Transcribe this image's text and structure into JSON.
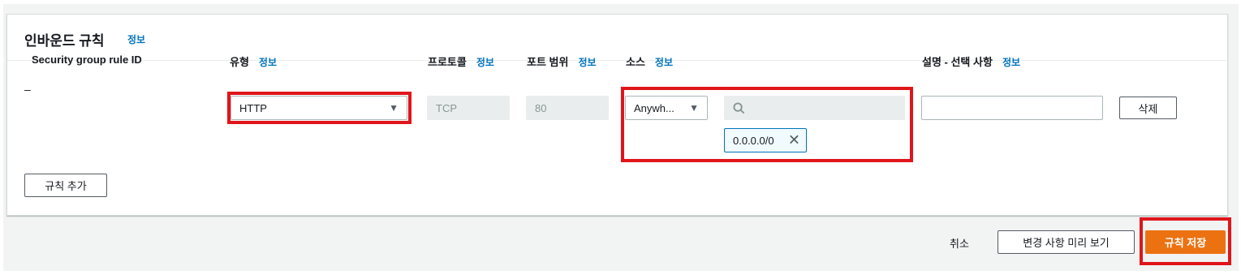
{
  "panel": {
    "title": "인바운드 규칙",
    "info": "정보"
  },
  "columns": {
    "rule_id": "Security group rule ID",
    "type": "유형",
    "type_info": "정보",
    "protocol": "프로토콜",
    "protocol_info": "정보",
    "port_range": "포트 범위",
    "port_range_info": "정보",
    "source": "소스",
    "source_info": "정보",
    "description": "설명 - 선택 사항",
    "description_info": "정보"
  },
  "rule": {
    "id": "–",
    "type": "HTTP",
    "protocol": "TCP",
    "port_range": "80",
    "source_type": "Anywh...",
    "search_placeholder": "",
    "cidr_token": "0.0.0.0/0",
    "description": "",
    "delete_label": "삭제"
  },
  "add_rule_label": "규칙 추가",
  "footer": {
    "cancel": "취소",
    "preview": "변경 사항 미리 보기",
    "save": "규칙 저장"
  },
  "icons": {
    "caret": "caret-down-icon",
    "search": "search-icon",
    "remove": "close-icon"
  },
  "colors": {
    "accent": "#ec7211",
    "link": "#0073bb",
    "highlight": "#e0151a"
  }
}
